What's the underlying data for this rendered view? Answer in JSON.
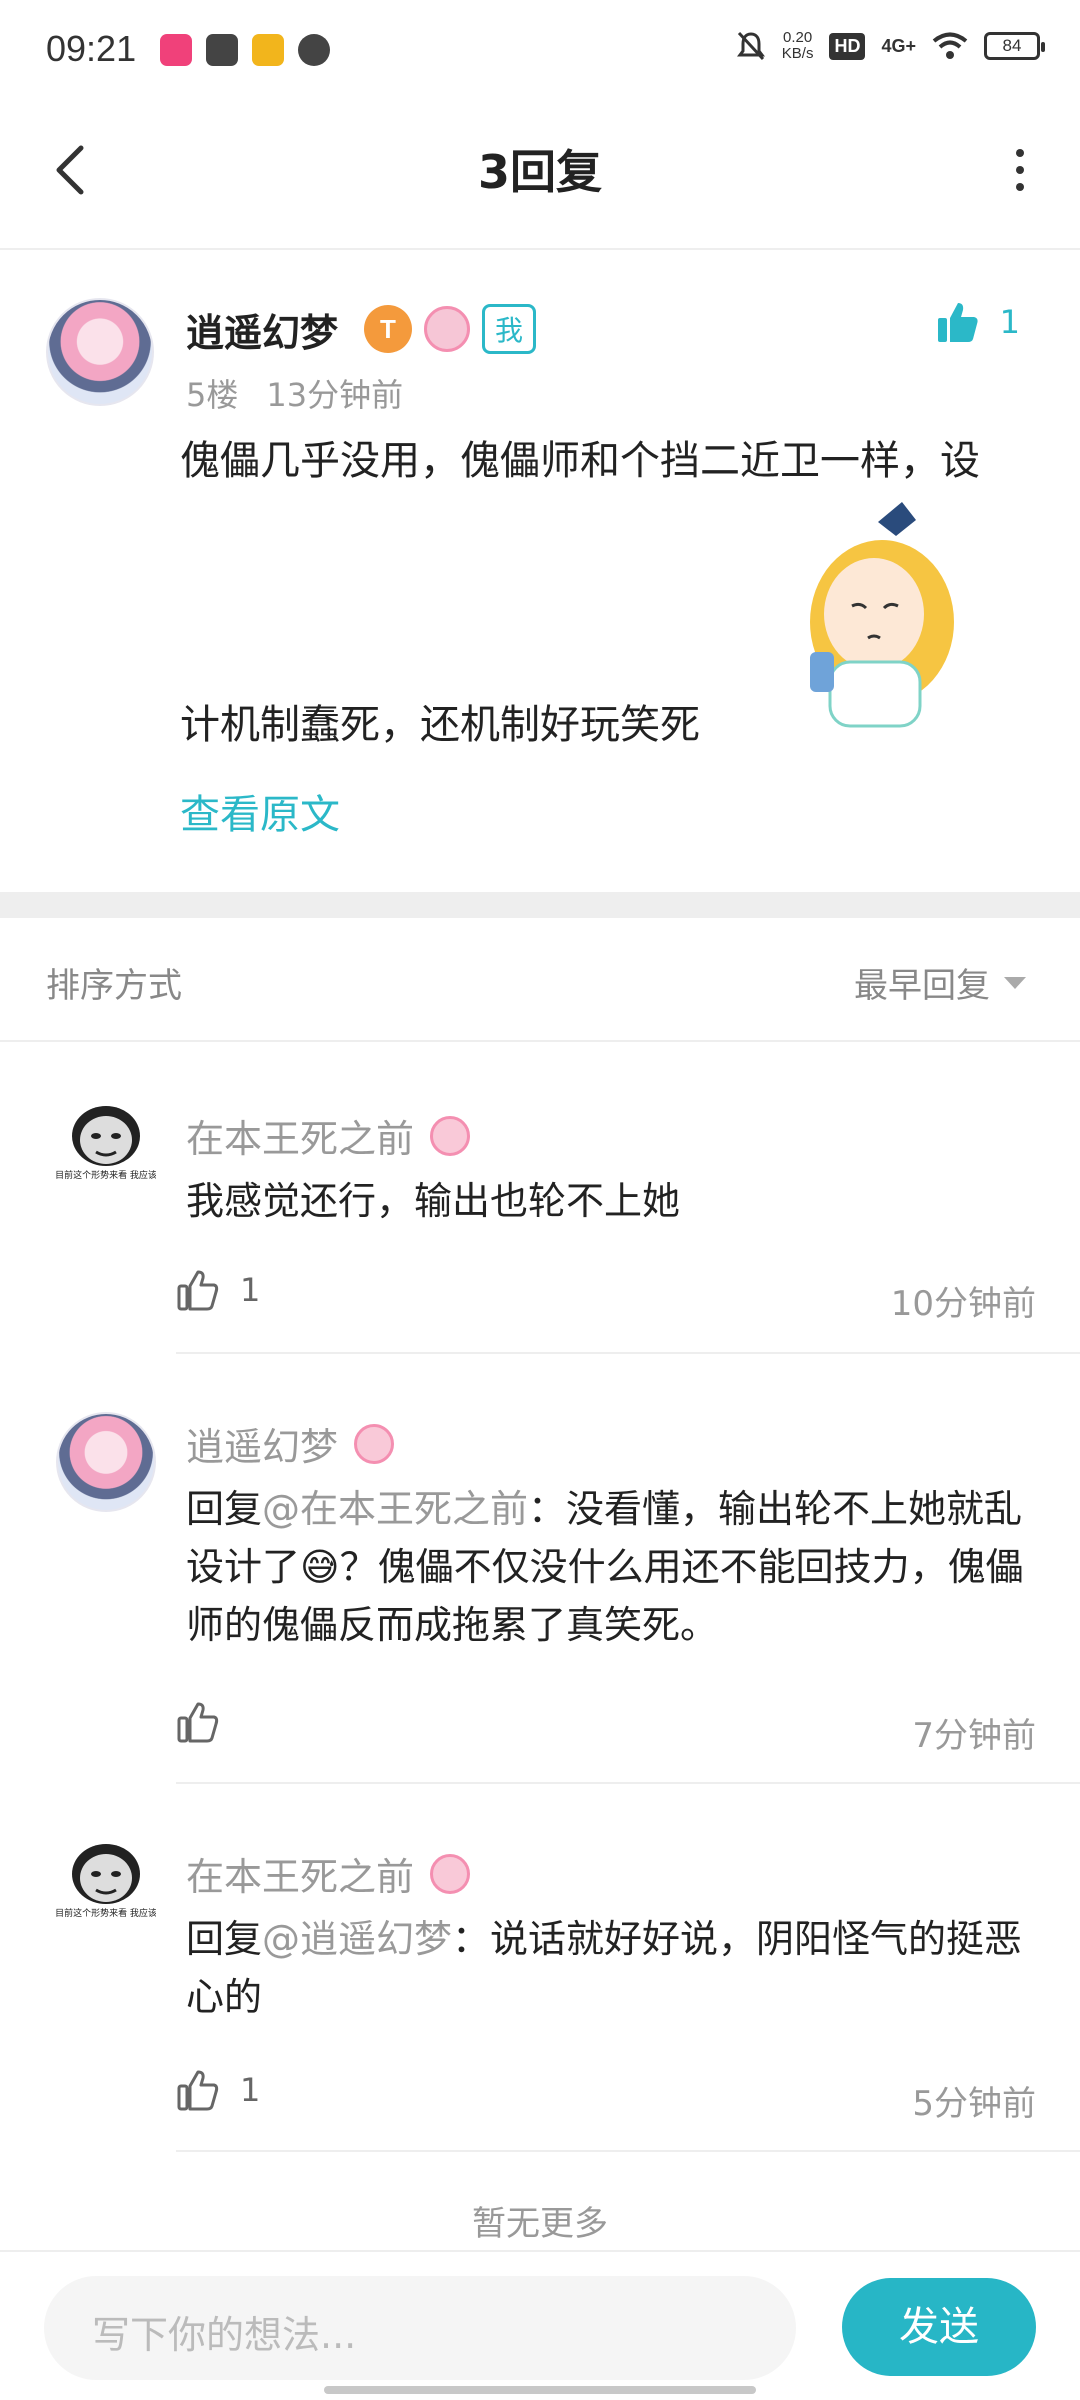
{
  "status_bar": {
    "time": "09:21",
    "net_speed_value": "0.20",
    "net_speed_unit": "KB/s",
    "hd": "HD",
    "network": "4G+",
    "battery": "84"
  },
  "header": {
    "title": "3回复"
  },
  "main_post": {
    "username": "逍遥幻梦",
    "badge_level": "T",
    "badge_me": "我",
    "like_count": "1",
    "floor": "5楼",
    "time": "13分钟前",
    "text_line1": "傀儡几乎没用，傀儡师和个挡二近卫一样，设",
    "text_line2": "计机制蠢死，还机制好玩笑死",
    "view_original": "查看原文"
  },
  "sort": {
    "label": "排序方式",
    "value": "最早回复"
  },
  "replies": [
    {
      "username": "在本王死之前",
      "avatar_caption": "照目前这个形势来看 我应该是",
      "text": "我感觉还行，输出也轮不上她",
      "likes": "1",
      "time": "10分钟前"
    },
    {
      "username": "逍遥幻梦",
      "prefix": "回复",
      "mention": "@在本王死之前",
      "text": "：没看懂，输出轮不上她就乱设计了😅？傀儡不仅没什么用还不能回技力，傀儡师的傀儡反而成拖累了真笑死。",
      "likes": "",
      "time": "7分钟前"
    },
    {
      "username": "在本王死之前",
      "avatar_caption": "照目前这个形势来看 我应该是",
      "prefix": "回复",
      "mention": "@逍遥幻梦",
      "text": "：说话就好好说，阴阳怪气的挺恶心的",
      "likes": "1",
      "time": "5分钟前"
    }
  ],
  "no_more": "暂无更多",
  "input": {
    "placeholder": "写下你的想法..."
  },
  "send_label": "发送",
  "colors": {
    "accent": "#27b6c6",
    "muted": "#999999",
    "badge_orange": "#f49a3c",
    "badge_pink": "#f48fb1"
  },
  "icons": [
    "back-arrow-icon",
    "more-vertical-icon",
    "thumbs-up-icon",
    "dropdown-triangle-icon"
  ]
}
